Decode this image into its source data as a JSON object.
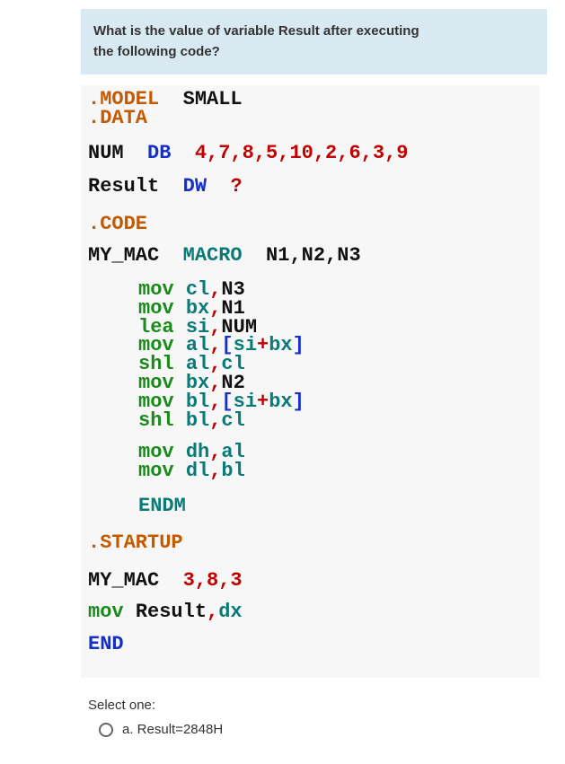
{
  "question": {
    "line1": "What is the value of variable Result after executing",
    "line2": "the following code?"
  },
  "code": {
    "model": ".MODEL",
    "model_arg": "SMALL",
    "data": ".DATA",
    "num_dir": "NUM",
    "db": "DB",
    "num_vals": "4,7,8,5,10,2,6,3,9",
    "result_dir": "Result",
    "dw": "DW",
    "qmark": "?",
    "code_dir": ".CODE",
    "my_mac": "MY_MAC",
    "macro_kw": "MACRO",
    "macro_args": "N1,N2,N3",
    "l_mov": "mov",
    "l_lea": "lea",
    "l_shl": "shl",
    "r_cl": "cl",
    "r_bx": "bx",
    "r_si": "si",
    "r_al": "al",
    "r_bl": "bl",
    "r_dh": "dh",
    "r_dl": "dl",
    "a_N1": "N1",
    "a_N2": "N2",
    "a_N3": "N3",
    "a_NUM": "NUM",
    "lbrack": "[",
    "rbrack": "]",
    "plus": "+",
    "comma": ",",
    "endm": "ENDM",
    "startup": ".STARTUP",
    "call_name": "MY_MAC",
    "call_args": "3,8,3",
    "mov_res": "Result",
    "mov_dx": "dx",
    "end": "END"
  },
  "select": {
    "title": "Select one:",
    "opt_a": "a. Result=2848H"
  }
}
